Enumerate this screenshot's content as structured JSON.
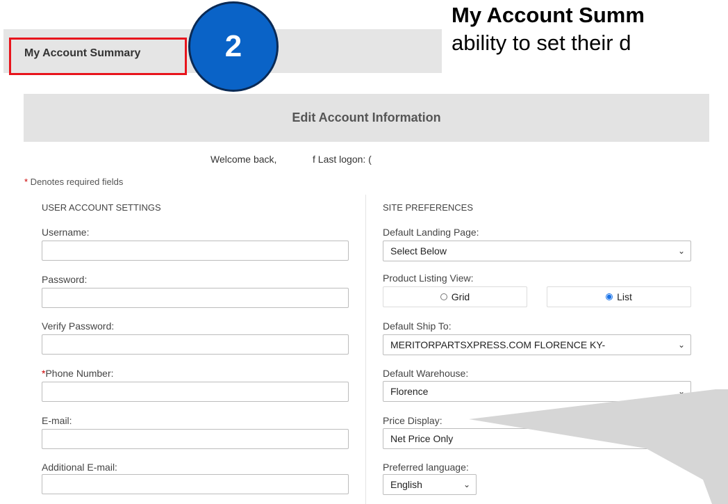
{
  "page_tab": {
    "label": "My Account Summary"
  },
  "step_badge": {
    "number": "2"
  },
  "headline": {
    "bold": "My Account Summ",
    "normal": "ability to set their d"
  },
  "section": {
    "title": "Edit Account Information"
  },
  "welcome": {
    "greeting": "Welcome back,",
    "last_logon": "f Last logon: ("
  },
  "required_note": {
    "star": "*",
    "text": " Denotes required fields"
  },
  "user_settings": {
    "header": "USER ACCOUNT SETTINGS",
    "username_label": "Username:",
    "password_label": "Password:",
    "verify_password_label": "Verify Password:",
    "phone_star": "*",
    "phone_label": "Phone Number:",
    "email_label": "E-mail:",
    "additional_email_label": "Additional E-mail:"
  },
  "site_prefs": {
    "header": "SITE PREFERENCES",
    "landing_label": "Default Landing Page:",
    "landing_value": "Select Below",
    "listing_label": "Product Listing View:",
    "grid_label": "Grid",
    "list_label": "List",
    "selected_view": "List",
    "ship_label": "Default Ship To:",
    "ship_value": "MERITORPARTSXPRESS.COM FLORENCE KY-",
    "warehouse_label": "Default Warehouse:",
    "warehouse_value": "Florence",
    "price_label": "Price Display:",
    "price_value": "Net Price Only",
    "language_label": "Preferred language:",
    "language_value": "English"
  },
  "icons": {
    "dropdown": "chevron-down-icon"
  },
  "colors": {
    "highlight": "#e8141c",
    "badge": "#0a63c7",
    "callout": "#d6d6d6"
  }
}
